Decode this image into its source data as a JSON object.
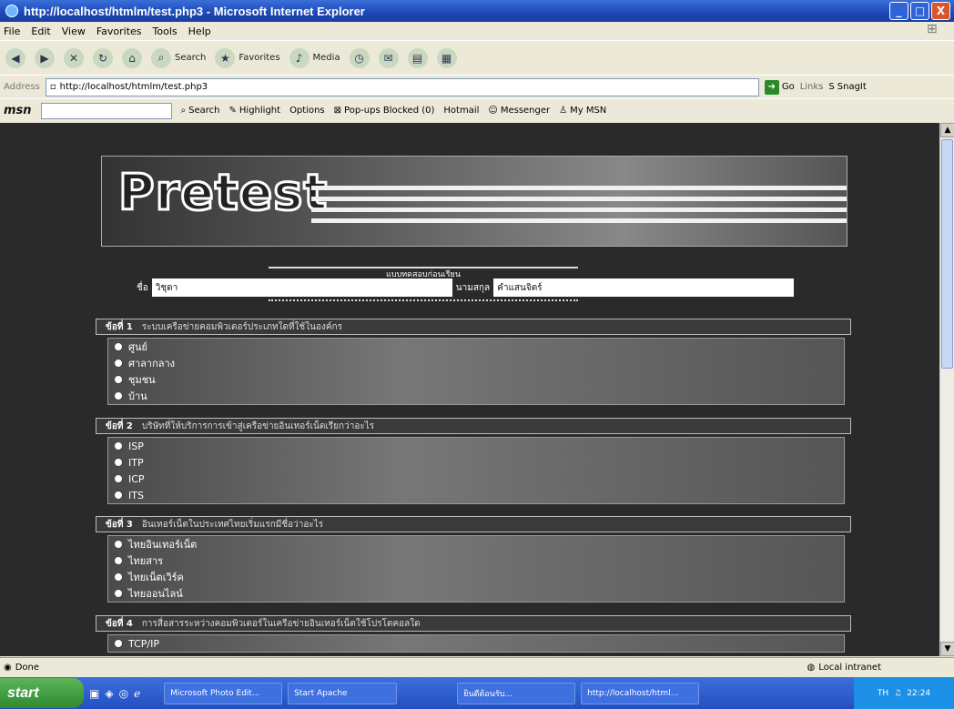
{
  "window": {
    "title": "http://localhost/htmlm/test.php3 - Microsoft Internet Explorer",
    "minimize": "_",
    "maximize": "□",
    "close": "X"
  },
  "menu": [
    "File",
    "Edit",
    "View",
    "Favorites",
    "Tools",
    "Help"
  ],
  "toolbar": {
    "search_label": "Search",
    "favorites_label": "Favorites",
    "media_label": "Media"
  },
  "address": {
    "label": "Address",
    "url": "http://localhost/htmlm/test.php3",
    "go_label": "Go",
    "links_label": "Links",
    "snagit_label": "SnagIt"
  },
  "msn": {
    "logo": "msn",
    "search_label": "Search",
    "highlight_label": "Highlight",
    "options_label": "Options",
    "popups_label": "Pop-ups Blocked (0)",
    "hotmail_label": "Hotmail",
    "messenger_label": "Messenger",
    "mymsn_label": "My MSN"
  },
  "page": {
    "logo_text": "Pretest",
    "subtitle": "แบบทดสอบก่อนเรียน",
    "name_label": "ชื่อ",
    "first_name": "วิชุดา",
    "surname_label": "นามสกุล",
    "surname": "คำแสนจิตร์",
    "questions": [
      {
        "label": "ข้อที่ 1",
        "text": "ระบบเครือข่ายคอมพิวเตอร์ประเภทใดที่ใช้ในองค์กร",
        "choices": [
          "ศูนย์",
          "ศาลากลาง",
          "ชุมชน",
          "บ้าน"
        ]
      },
      {
        "label": "ข้อที่ 2",
        "text": "บริษัทที่ให้บริการการเข้าสู่เครือข่ายอินเทอร์เน็ตเรียกว่าอะไร",
        "choices": [
          "ISP",
          "ITP",
          "ICP",
          "ITS"
        ]
      },
      {
        "label": "ข้อที่ 3",
        "text": "อินเทอร์เน็ตในประเทศไทยเริ่มแรกมีชื่อว่าอะไร",
        "choices": [
          "ไทยอินเทอร์เน็ต",
          "ไทยสาร",
          "ไทยเน็ตเวิร์ค",
          "ไทยออนไลน์"
        ]
      },
      {
        "label": "ข้อที่ 4",
        "text": "การสื่อสารระหว่างคอมพิวเตอร์ในเครือข่ายอินเทอร์เน็ตใช้โปรโตคอลใด",
        "choices": [
          "TCP/IP"
        ]
      }
    ]
  },
  "status": {
    "left": "Done",
    "zone": "Local intranet"
  },
  "taskbar": {
    "start": "start",
    "tasks": [
      "Microsoft Photo Edit...",
      "Start Apache",
      "ยินดีต้อนรับ...",
      "http://localhost/html..."
    ],
    "lang": "TH",
    "clock": "22:24"
  }
}
